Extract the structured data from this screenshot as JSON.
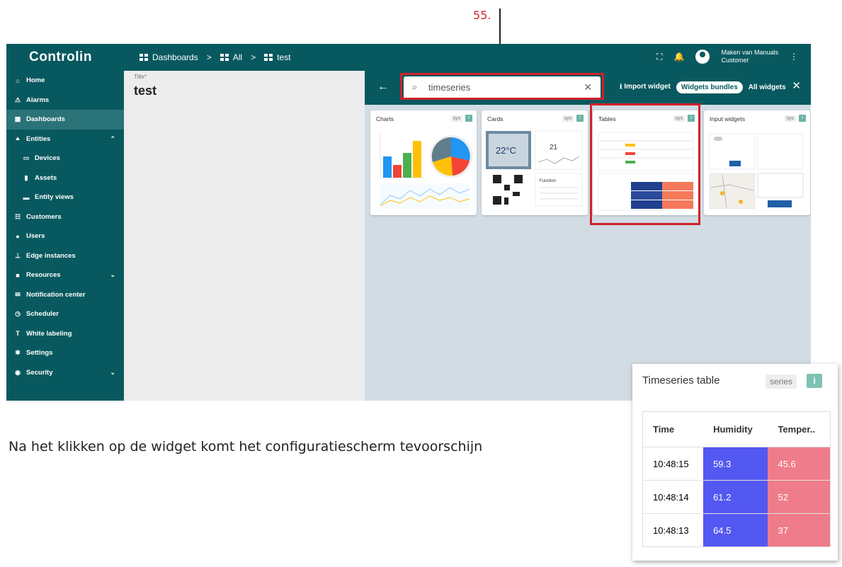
{
  "callout": {
    "number": "55."
  },
  "app": {
    "logo": "Controlin"
  },
  "breadcrumb": {
    "items": [
      "Dashboards",
      "All",
      "test"
    ],
    "separator": ">"
  },
  "user": {
    "name": "Maken van Manuals",
    "role": "Customer"
  },
  "sidebar": {
    "items": [
      {
        "label": "Home",
        "icon": "home-icon"
      },
      {
        "label": "Alarms",
        "icon": "alarm-icon"
      },
      {
        "label": "Dashboards",
        "icon": "dashboard-icon",
        "active": true
      },
      {
        "label": "Entities",
        "icon": "entities-icon",
        "expanded": true
      },
      {
        "label": "Devices",
        "icon": "device-icon",
        "sub": true
      },
      {
        "label": "Assets",
        "icon": "asset-icon",
        "sub": true
      },
      {
        "label": "Entity views",
        "icon": "entity-view-icon",
        "sub": true
      },
      {
        "label": "Customers",
        "icon": "customers-icon"
      },
      {
        "label": "Users",
        "icon": "users-icon"
      },
      {
        "label": "Edge instances",
        "icon": "edge-icon"
      },
      {
        "label": "Resources",
        "icon": "resources-icon",
        "collapsed": true
      },
      {
        "label": "Notification center",
        "icon": "notification-icon"
      },
      {
        "label": "Scheduler",
        "icon": "scheduler-icon"
      },
      {
        "label": "White labeling",
        "icon": "white-label-icon"
      },
      {
        "label": "Settings",
        "icon": "settings-icon"
      },
      {
        "label": "Security",
        "icon": "security-icon",
        "collapsed": true
      }
    ]
  },
  "dashboard": {
    "title_label": "Title*",
    "title_value": "test"
  },
  "widget_panel": {
    "search_value": "timeseries",
    "import_label": "Import widget",
    "bundles_label": "Widgets bundles",
    "all_label": "All widgets",
    "cards": [
      {
        "name": "Charts",
        "badge": "sys"
      },
      {
        "name": "Cards",
        "badge": "sys"
      },
      {
        "name": "Tables",
        "badge": "sys"
      },
      {
        "name": "Input widgets",
        "badge": "sys"
      }
    ],
    "cards_preview_text": {
      "temp": "22°C",
      "reading": "21",
      "function": "Function"
    }
  },
  "caption": "Na het klikken op de widget komt het configuratiescherm tevoorschijn",
  "timeseries_widget": {
    "title": "Timeseries table",
    "badge": "series",
    "info": "i",
    "columns": [
      "Time",
      "Humidity",
      "Temper.."
    ],
    "rows": [
      {
        "time": "10:48:15",
        "humidity": "59.3",
        "temperature": "45.6"
      },
      {
        "time": "10:48:14",
        "humidity": "61.2",
        "temperature": "52"
      },
      {
        "time": "10:48:13",
        "humidity": "64.5",
        "temperature": "37"
      }
    ]
  },
  "colors": {
    "brand": "#08595f",
    "highlight": "#d0212b",
    "humidity": "#5458f2",
    "temperature": "#ef7c8a"
  }
}
